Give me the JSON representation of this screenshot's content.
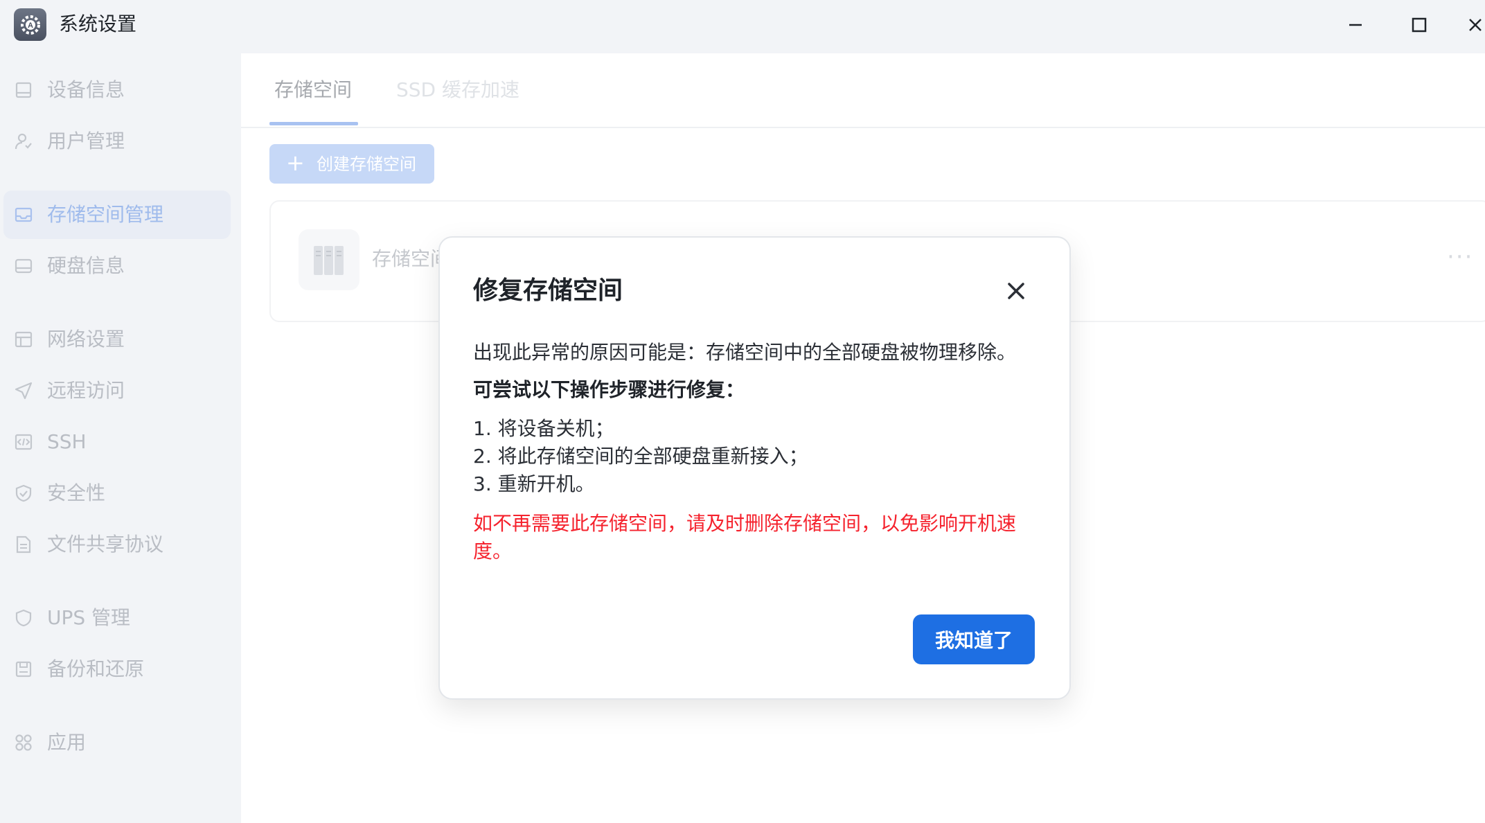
{
  "window": {
    "title": "系统设置"
  },
  "sidebar": {
    "items": [
      {
        "label": "设备信息",
        "icon": "monitor-icon",
        "active": false
      },
      {
        "label": "用户管理",
        "icon": "user-icon",
        "active": false
      },
      {
        "label": "存储空间管理",
        "icon": "storage-icon",
        "active": true
      },
      {
        "label": "硬盘信息",
        "icon": "disk-icon",
        "active": false
      },
      {
        "label": "网络设置",
        "icon": "network-icon",
        "active": false
      },
      {
        "label": "远程访问",
        "icon": "send-icon",
        "active": false
      },
      {
        "label": "SSH",
        "icon": "code-icon",
        "active": false
      },
      {
        "label": "安全性",
        "icon": "shield-check-icon",
        "active": false
      },
      {
        "label": "文件共享协议",
        "icon": "document-icon",
        "active": false
      },
      {
        "label": "UPS 管理",
        "icon": "shield-icon",
        "active": false
      },
      {
        "label": "备份和还原",
        "icon": "save-icon",
        "active": false
      },
      {
        "label": "应用",
        "icon": "apps-icon",
        "active": false
      }
    ]
  },
  "main": {
    "tabs": [
      {
        "label": "存储空间",
        "active": true
      },
      {
        "label": "SSD 缓存加速",
        "active": false
      }
    ],
    "create_button": "创建存储空间",
    "pool": {
      "name": "存储空间"
    }
  },
  "modal": {
    "title": "修复存储空间",
    "reason": "出现此异常的原因可能是：存储空间中的全部硬盘被物理移除。",
    "steps_title": "可尝试以下操作步骤进行修复：",
    "steps": [
      "1. 将设备关机；",
      "2. 将此存储空间的全部硬盘重新接入；",
      "3. 重新开机。"
    ],
    "warning": "如不再需要此存储空间，请及时删除存储空间，以免影响开机速度。",
    "ok_button": "我知道了"
  },
  "colors": {
    "primary": "#1e6fe3",
    "warning": "#f5222d",
    "sidebar_bg": "#f2f4f7"
  }
}
